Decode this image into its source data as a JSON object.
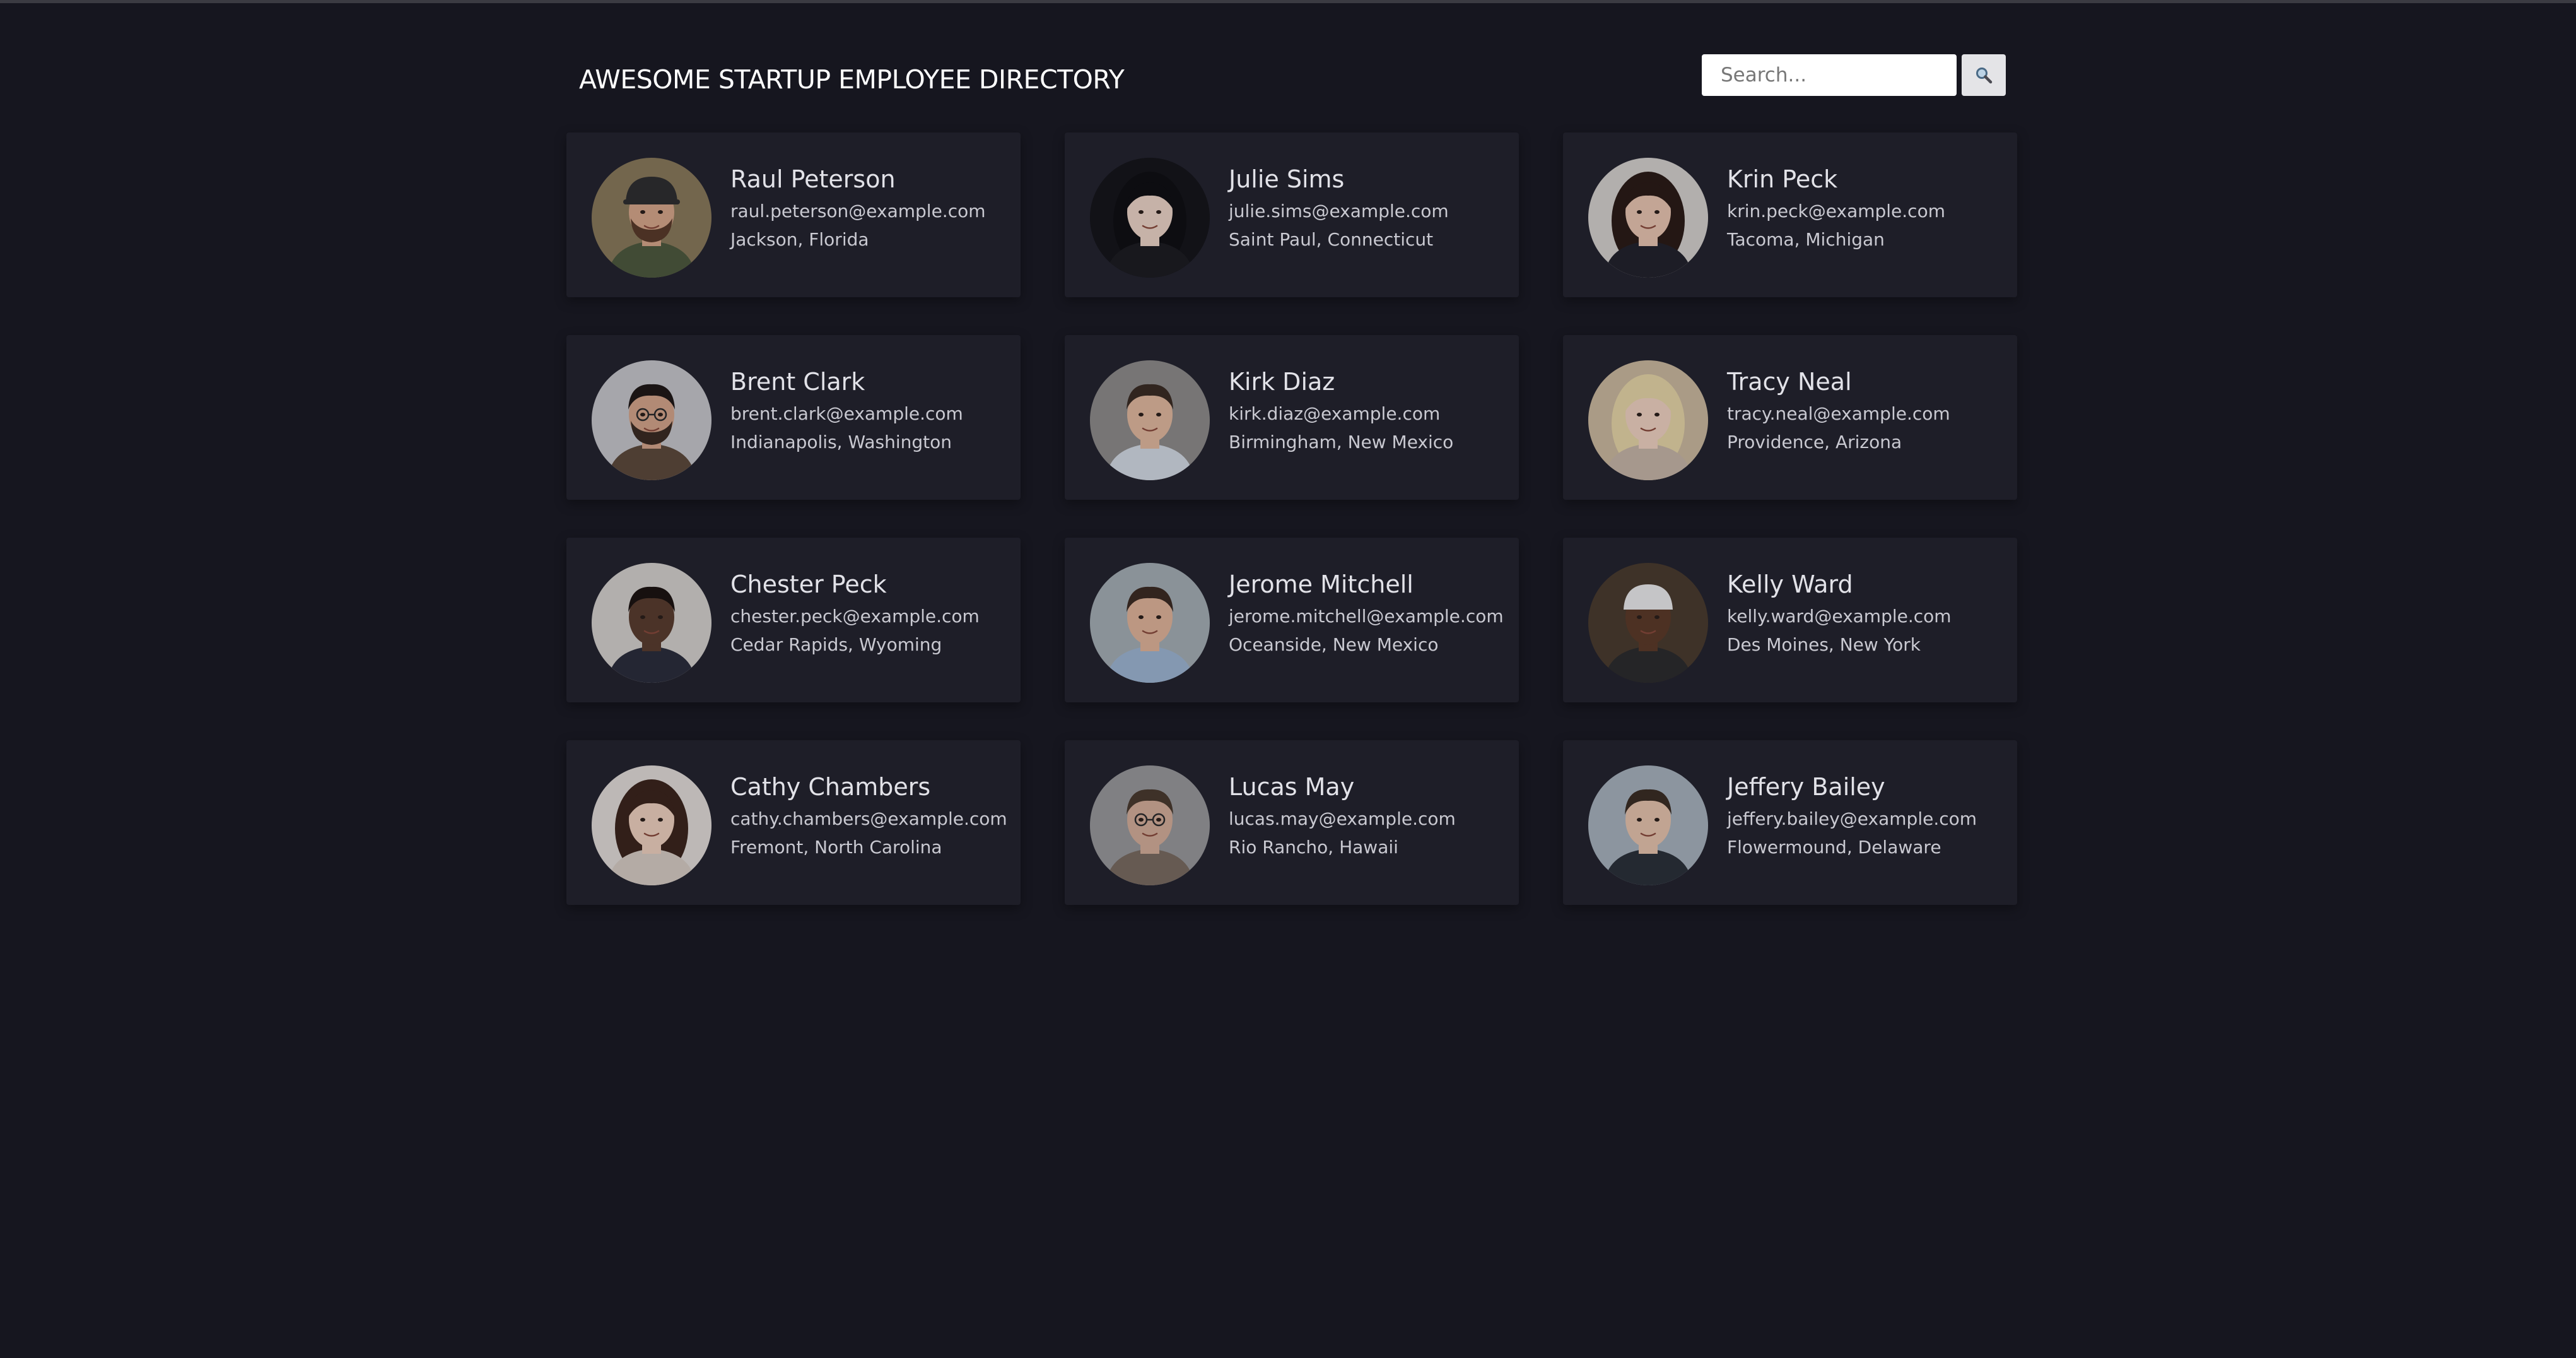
{
  "header": {
    "title": "AWESOME STARTUP EMPLOYEE DIRECTORY",
    "search_placeholder": "Search..."
  },
  "icons": {
    "search_button": "magnifier-icon"
  },
  "colors": {
    "background": "#16161f",
    "card": "#1e1e28",
    "text": "#e2e2e8"
  },
  "employees": [
    {
      "name": "Raul Peterson",
      "email": "raul.peterson@example.com",
      "location": "Jackson, Florida"
    },
    {
      "name": "Julie Sims",
      "email": "julie.sims@example.com",
      "location": "Saint Paul, Connecticut"
    },
    {
      "name": "Krin Peck",
      "email": "krin.peck@example.com",
      "location": "Tacoma, Michigan"
    },
    {
      "name": "Brent Clark",
      "email": "brent.clark@example.com",
      "location": "Indianapolis, Washington"
    },
    {
      "name": "Kirk Diaz",
      "email": "kirk.diaz@example.com",
      "location": "Birmingham, New Mexico"
    },
    {
      "name": "Tracy Neal",
      "email": "tracy.neal@example.com",
      "location": "Providence, Arizona"
    },
    {
      "name": "Chester Peck",
      "email": "chester.peck@example.com",
      "location": "Cedar Rapids, Wyoming"
    },
    {
      "name": "Jerome Mitchell",
      "email": "jerome.mitchell@example.com",
      "location": "Oceanside, New Mexico"
    },
    {
      "name": "Kelly Ward",
      "email": "kelly.ward@example.com",
      "location": "Des Moines, New York"
    },
    {
      "name": "Cathy Chambers",
      "email": "cathy.chambers@example.com",
      "location": "Fremont, North Carolina"
    },
    {
      "name": "Lucas May",
      "email": "lucas.may@example.com",
      "location": "Rio Rancho, Hawaii"
    },
    {
      "name": "Jeffery Bailey",
      "email": "jeffery.bailey@example.com",
      "location": "Flowermound, Delaware"
    }
  ]
}
